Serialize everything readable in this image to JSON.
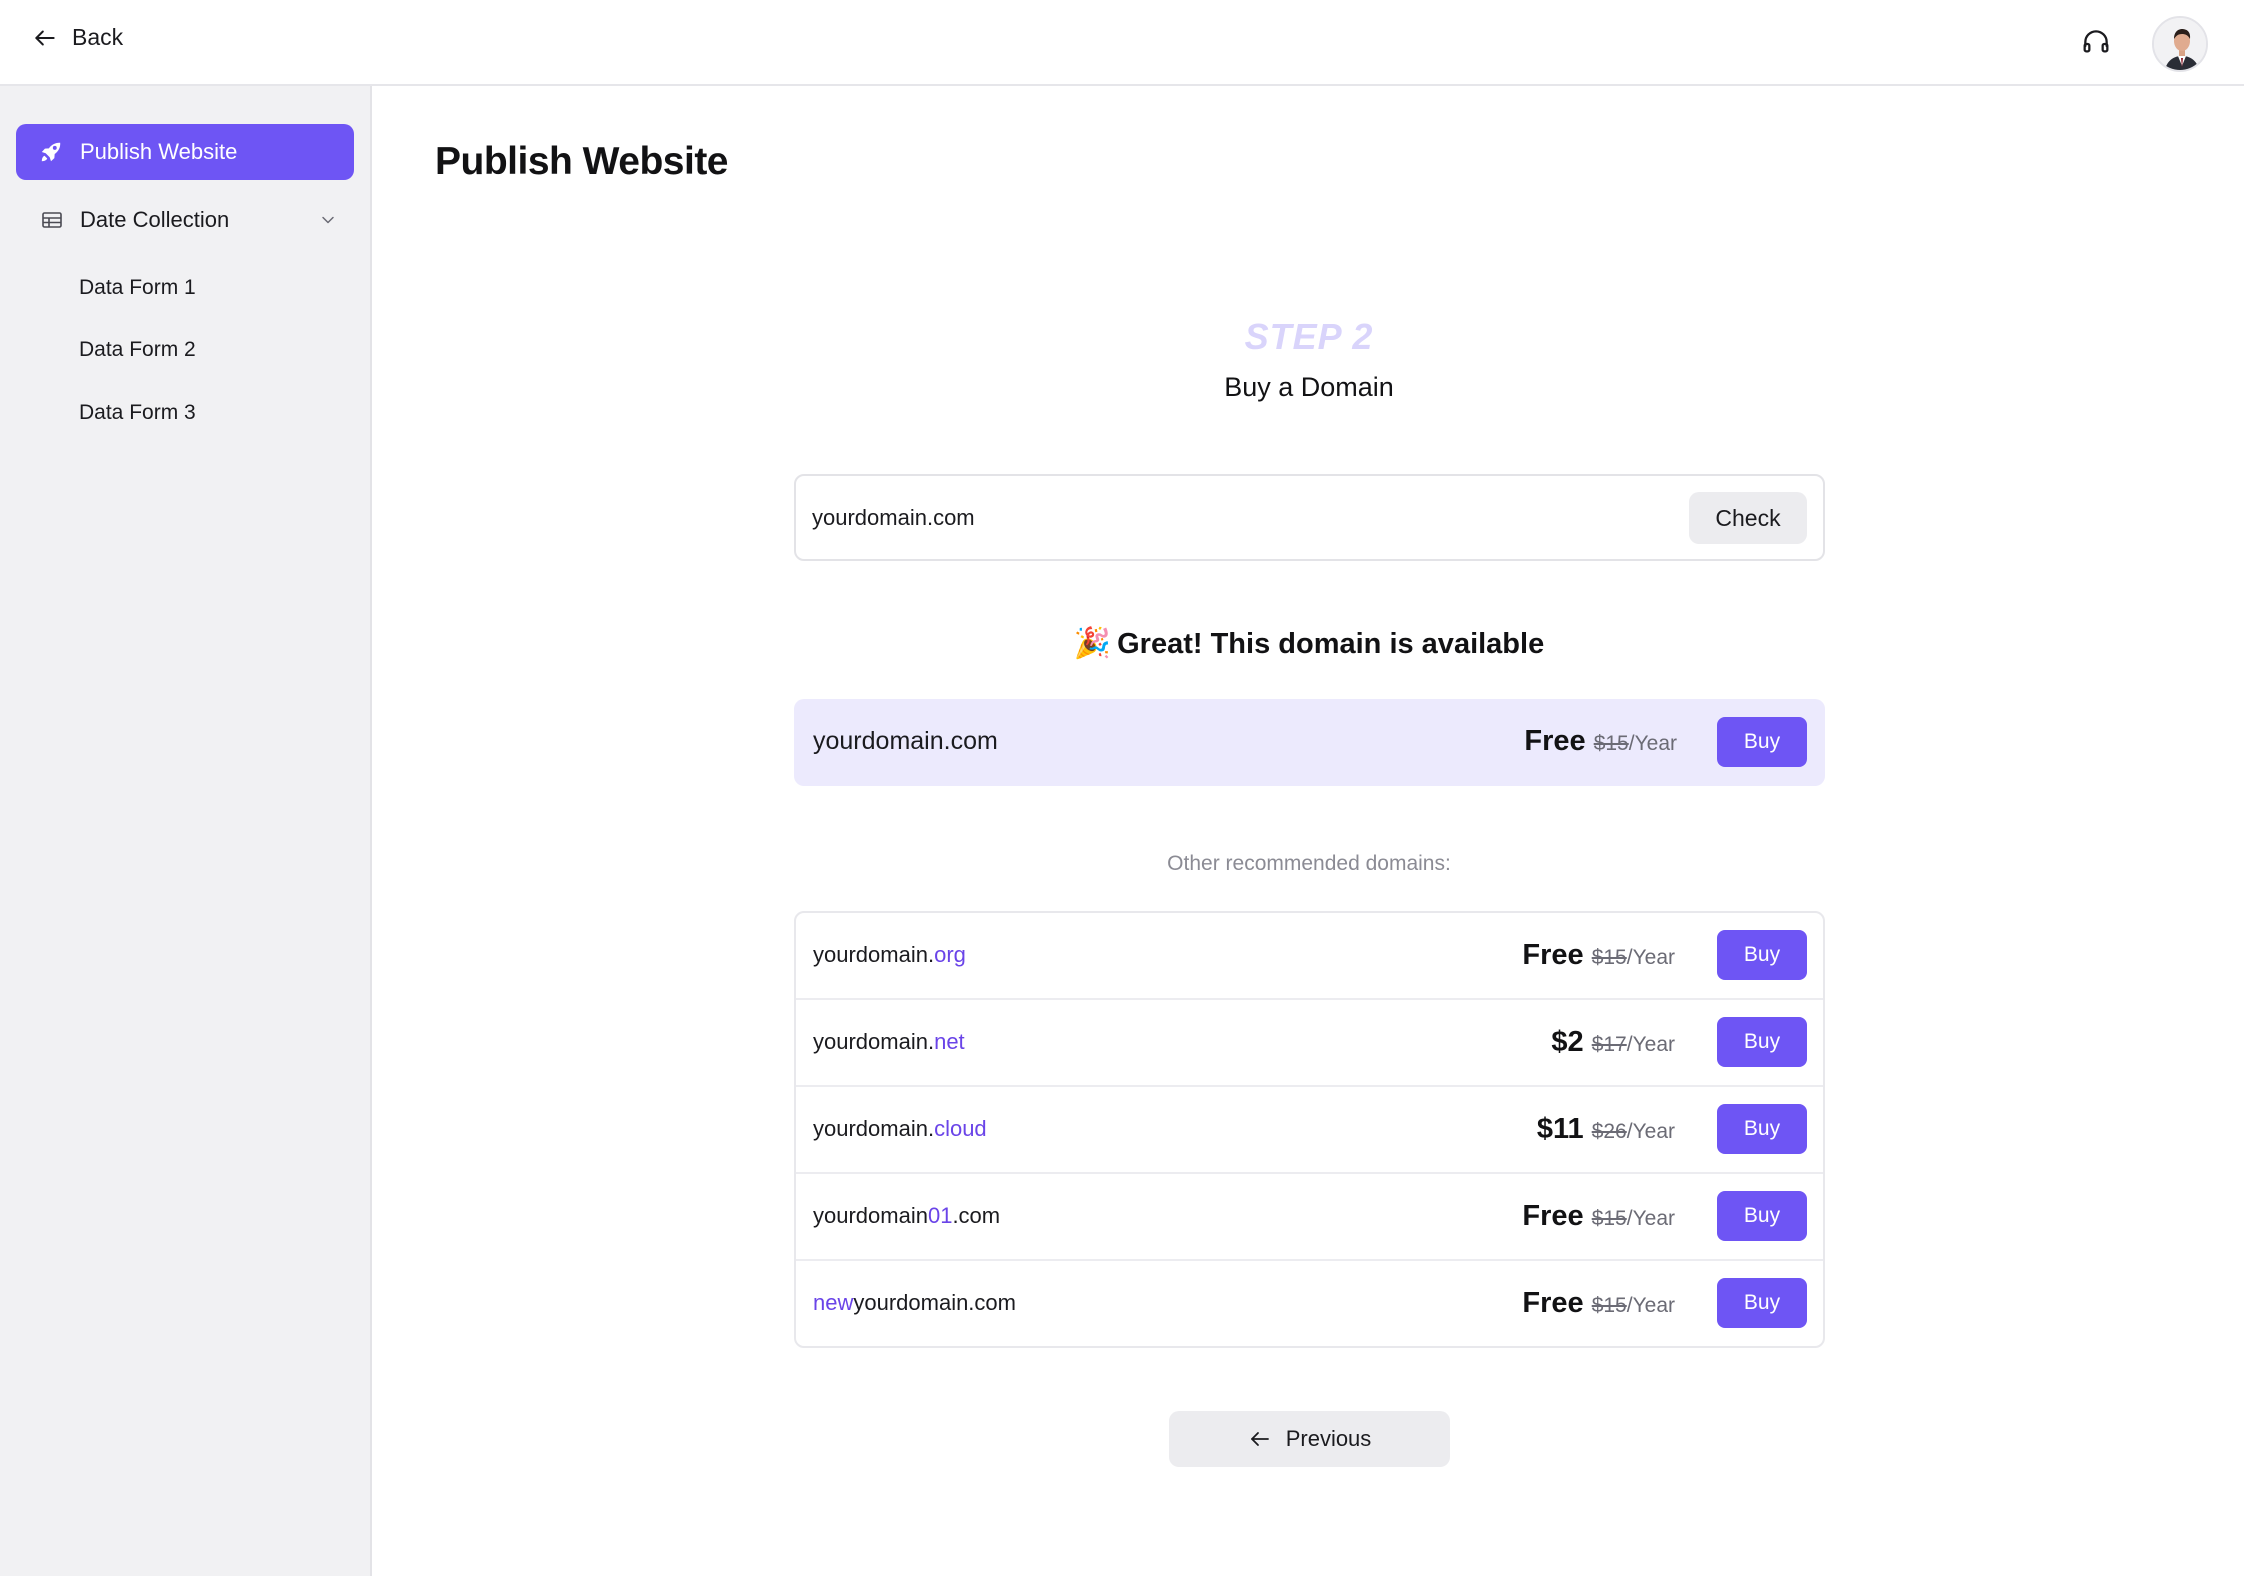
{
  "topbar": {
    "back_label": "Back",
    "support_icon": "headset-icon",
    "avatar_icon": "user-avatar"
  },
  "sidebar": {
    "active_item": {
      "label": "Publish Website",
      "icon": "rocket-icon"
    },
    "group": {
      "label": "Date Collection",
      "icon": "table-icon",
      "expanded": true
    },
    "sub_items": [
      {
        "label": "Data Form 1"
      },
      {
        "label": "Data Form 2"
      },
      {
        "label": "Data Form 3"
      }
    ]
  },
  "main": {
    "title": "Publish Website",
    "step_label": "STEP 2",
    "step_title": "Buy a Domain",
    "search": {
      "value": "yourdomain.com",
      "button_label": "Check"
    },
    "availability": {
      "emoji": "🎉",
      "message": "Great! This domain is available"
    },
    "featured": {
      "domain": "yourdomain.com",
      "price": "Free",
      "old_price": "$15",
      "period": "/Year",
      "buy_label": "Buy"
    },
    "other_label": "Other recommended domains:",
    "recommended": [
      {
        "prefix": "",
        "pre": "yourdomain.",
        "highlight": "org",
        "post": "",
        "price": "Free",
        "old_price": "$15",
        "period": "/Year",
        "buy_label": "Buy"
      },
      {
        "prefix": "",
        "pre": "yourdomain.",
        "highlight": "net",
        "post": "",
        "price": "$2",
        "old_price": "$17",
        "period": "/Year",
        "buy_label": "Buy"
      },
      {
        "prefix": "",
        "pre": "yourdomain.",
        "highlight": "cloud",
        "post": "",
        "price": "$11",
        "old_price": "$26",
        "period": "/Year",
        "buy_label": "Buy"
      },
      {
        "prefix": "",
        "pre": "yourdomain",
        "highlight": "01",
        "post": ".com",
        "price": "Free",
        "old_price": "$15",
        "period": "/Year",
        "buy_label": "Buy"
      },
      {
        "prefix": "new",
        "pre": "yourdomain.com",
        "highlight": "",
        "post": "",
        "price": "Free",
        "old_price": "$15",
        "period": "/Year",
        "buy_label": "Buy"
      }
    ],
    "previous_label": "Previous"
  },
  "colors": {
    "accent": "#6e55f4",
    "accent_light": "#eceafd",
    "highlight_text": "#6a44e8",
    "sidebar_bg": "#f1f1f3"
  }
}
